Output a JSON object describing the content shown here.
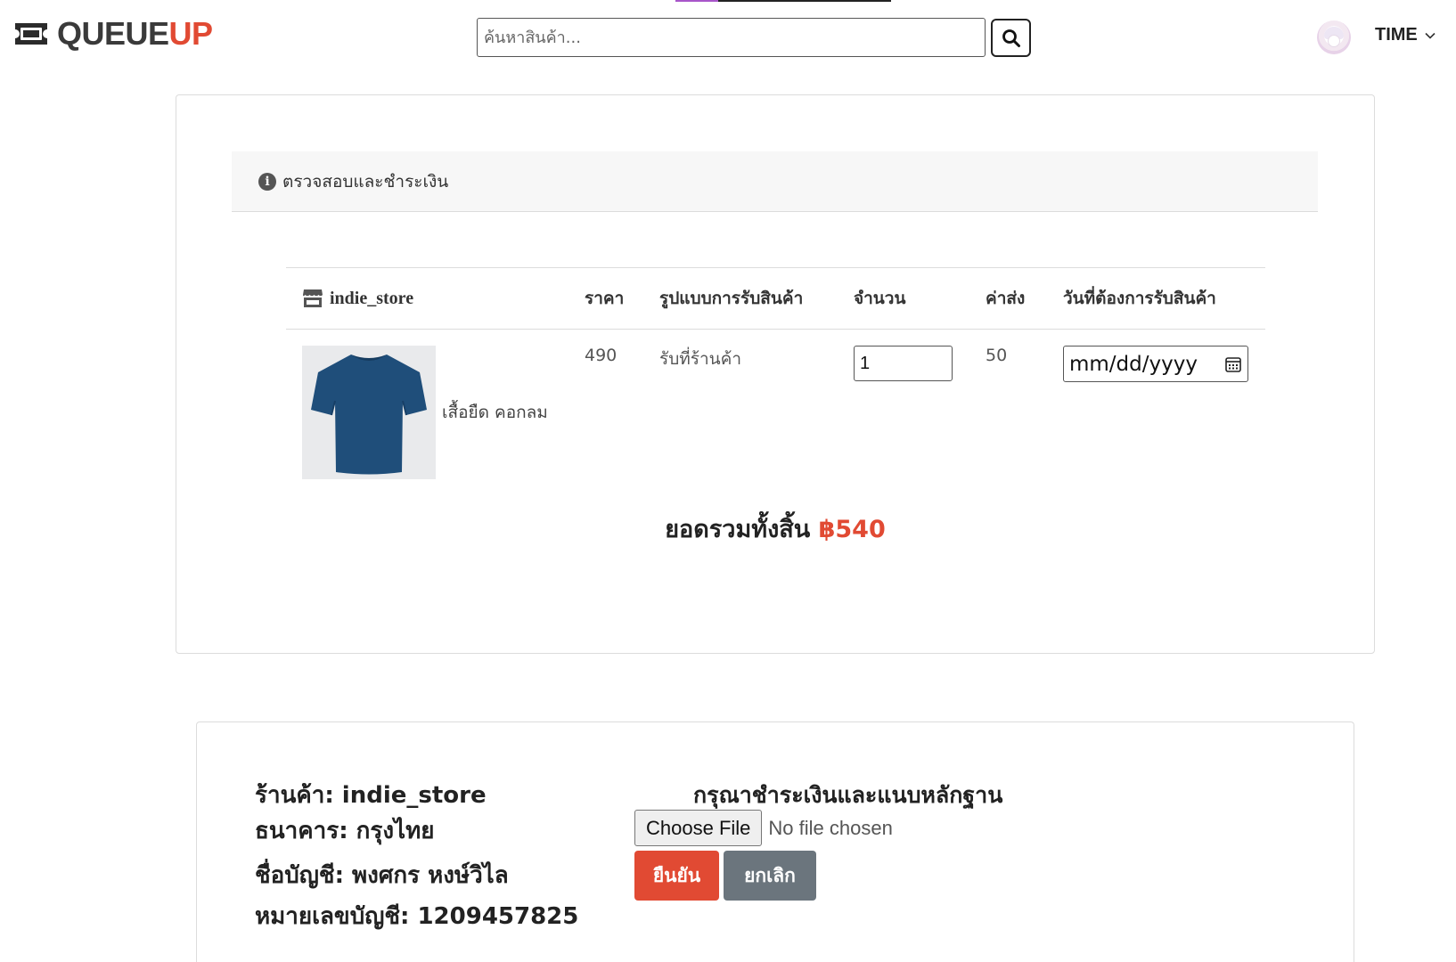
{
  "brand": {
    "name_part1": "QUEUE",
    "name_part2": "UP",
    "accent_color": "#e14a33"
  },
  "search": {
    "placeholder": "ค้นหาสินค้า..."
  },
  "user": {
    "name": "TIME"
  },
  "checkout": {
    "section_title": "ตรวจสอบและชำระเงิน",
    "columns": {
      "store": "indie_store",
      "price": "ราคา",
      "delivery": "รูปแบบการรับสินค้า",
      "quantity": "จำนวน",
      "shipping": "ค่าส่ง",
      "date": "วันที่ต้องการรับสินค้า"
    },
    "item": {
      "name": "เสื้อยืด คอกลม",
      "price": "490",
      "delivery": "รับที่ร้านค้า",
      "quantity": "1",
      "shipping": "50",
      "date_placeholder": "mm/dd/yyyy",
      "image_color": "#1f4e7a"
    },
    "total_label": "ยอดรวมทั้งสิ้น",
    "total_amount": "฿540"
  },
  "payment": {
    "store_line": "ร้านค้า: indie_store",
    "bank_line": "ธนาคาร: กรุงไทย",
    "account_name_line": "ชื่อบัญชี: พงศกร หงษ์วิไล",
    "account_number_line": "หมายเลขบัญชี: 1209457825",
    "title": "กรุณาชำระเงินและแนบหลักฐาน",
    "file_button": "Choose File",
    "file_status": "No file chosen",
    "confirm_button": "ยืนยัน",
    "cancel_button": "ยกเลิก"
  }
}
